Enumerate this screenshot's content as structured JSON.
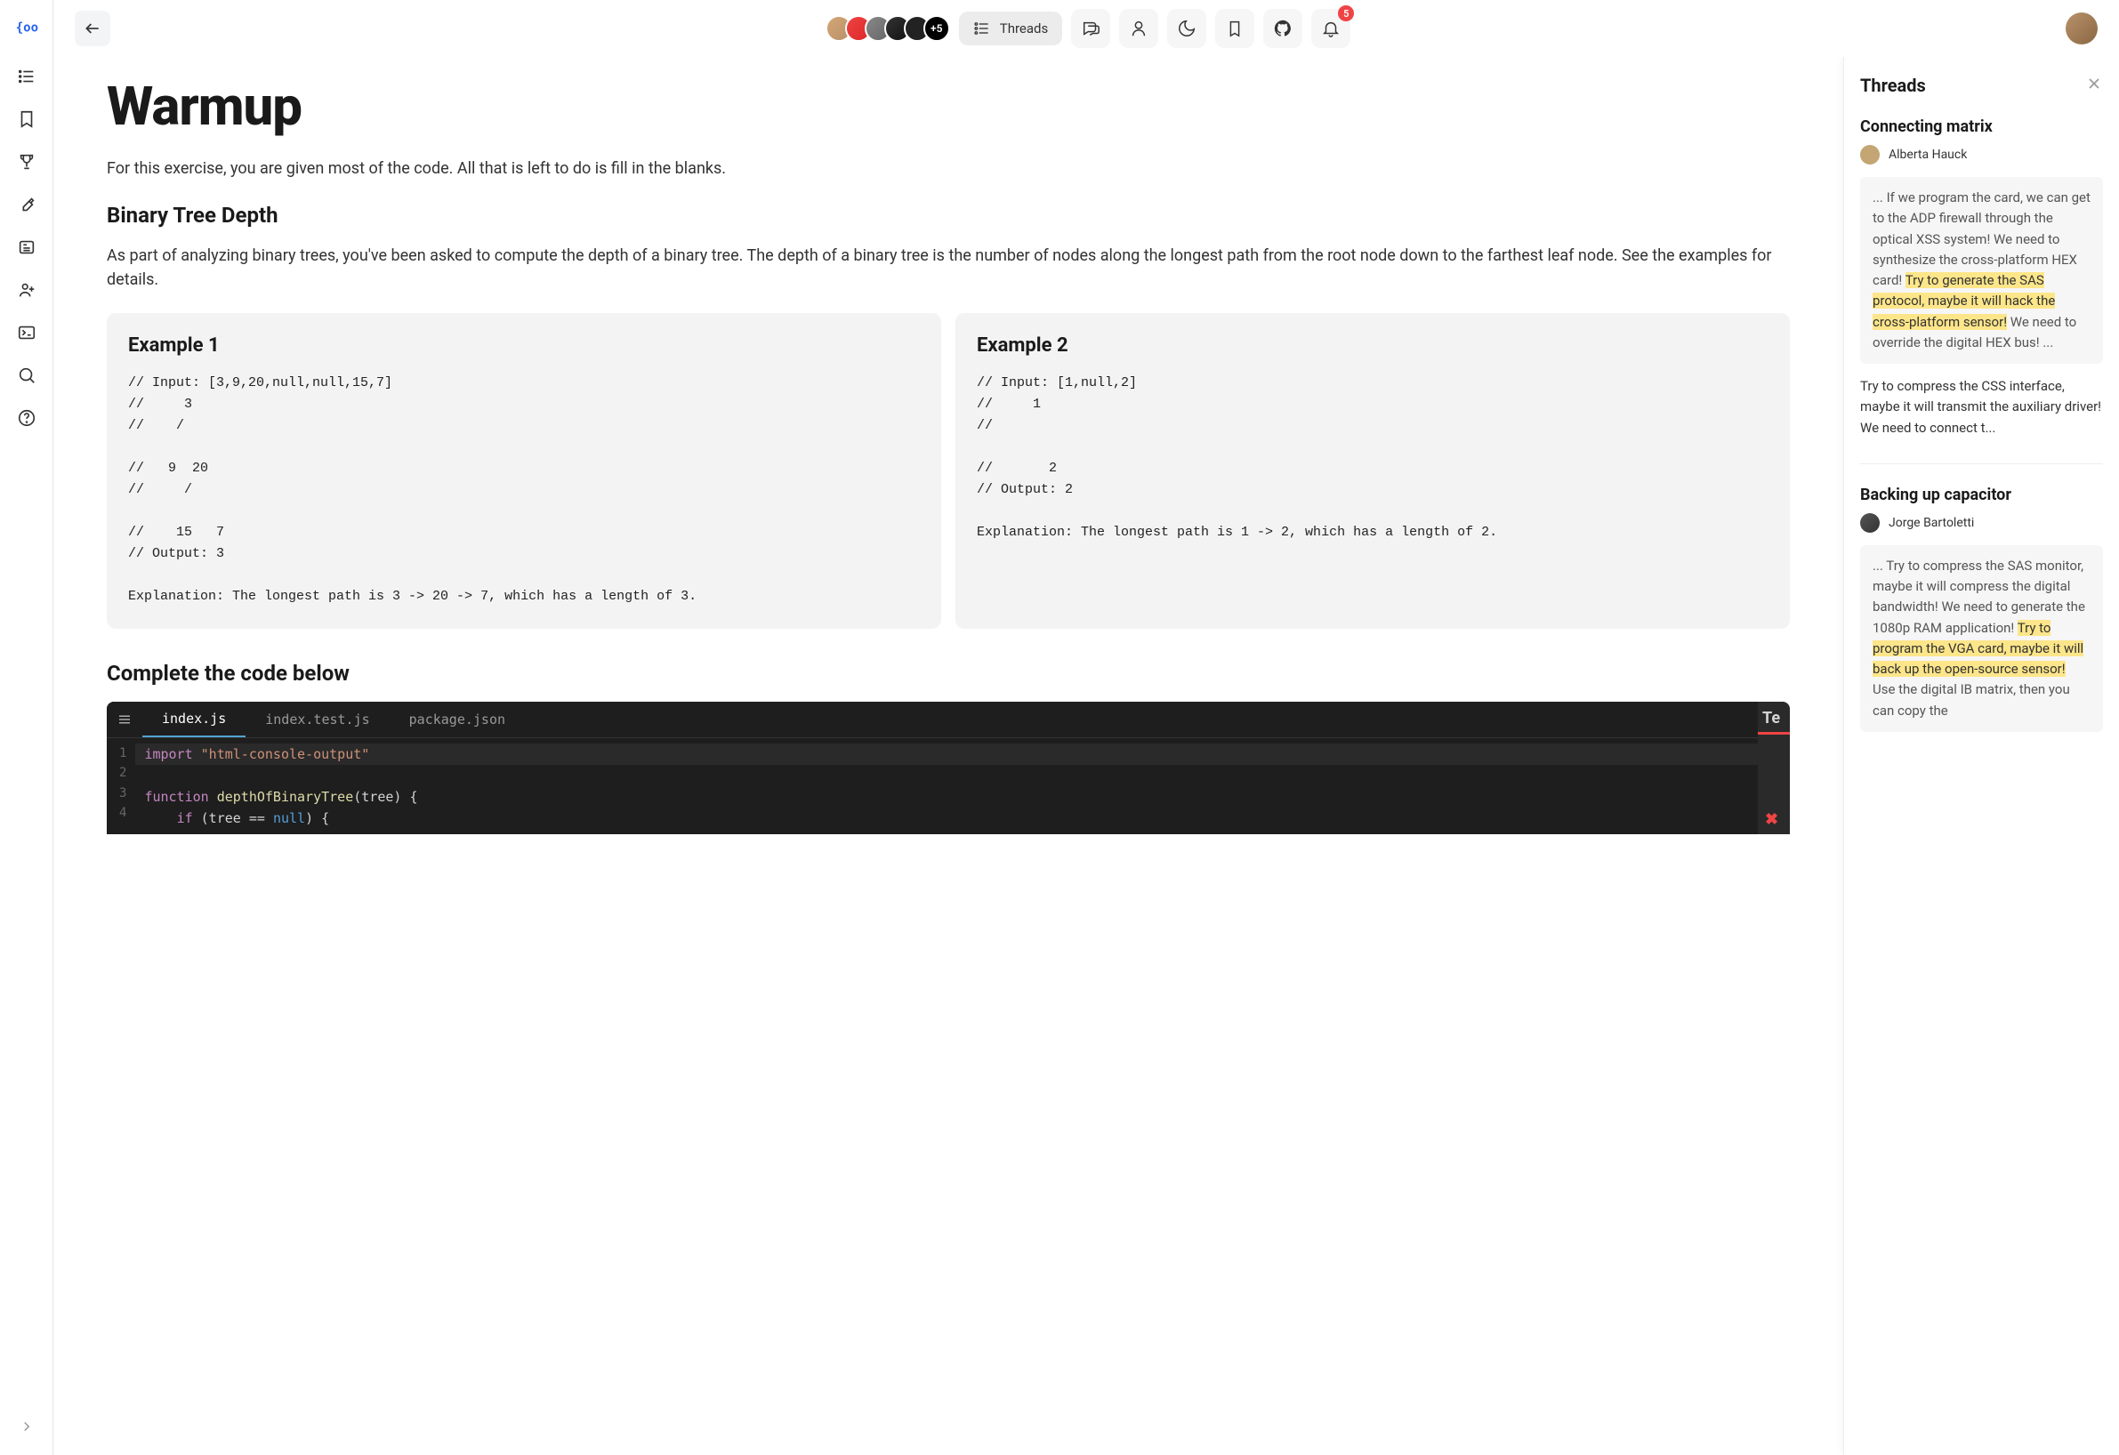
{
  "rail": {},
  "topbar": {
    "avatar_more": "+5",
    "threads_label": "Threads",
    "notification_count": "5"
  },
  "page": {
    "title": "Warmup",
    "intro": "For this exercise, you are given most of the code. All that is left to do is fill in the blanks.",
    "section_heading": "Binary Tree Depth",
    "section_body": "As part of analyzing binary trees, you've been asked to compute the depth of a binary tree. The depth of a binary tree is the number of nodes along the longest path from the root node down to the farthest leaf node. See the examples for details.",
    "examples": [
      {
        "title": "Example 1",
        "code": "// Input: [3,9,20,null,null,15,7]\n//     3\n//    /\n\n//   9  20\n//     /\n\n//    15   7\n// Output: 3\n\nExplanation: The longest path is 3 -> 20 -> 7, which has a length of 3."
      },
      {
        "title": "Example 2",
        "code": "// Input: [1,null,2]\n//     1\n//\n\n//       2\n// Output: 2\n\nExplanation: The longest path is 1 -> 2, which has a length of 2."
      }
    ],
    "complete_heading": "Complete the code below"
  },
  "editor": {
    "tabs": [
      {
        "label": "index.js",
        "active": true
      },
      {
        "label": "index.test.js",
        "active": false
      },
      {
        "label": "package.json",
        "active": false
      }
    ],
    "lines": [
      "1",
      "2",
      "3",
      "4"
    ],
    "code": {
      "l1_kw": "import",
      "l1_str": "\"html-console-output\"",
      "l3_kw": "function",
      "l3_fn": "depthOfBinaryTree",
      "l3_rest": "(tree) {",
      "l4_kw": "if",
      "l4_cond": " (tree == ",
      "l4_null": "null",
      "l4_end": ") {"
    },
    "test_label": "Te",
    "test_close": "✖"
  },
  "threads_panel": {
    "title": "Threads",
    "items": [
      {
        "title": "Connecting matrix",
        "author": "Alberta Hauck",
        "quote_pre": "... If we program the card, we can get to the ADP firewall through the optical XSS system! We need to synthesize the cross-platform HEX card! ",
        "quote_hl": "Try to generate the SAS protocol, maybe it will hack the cross-platform sensor!",
        "quote_post": " We need to override the digital HEX bus! ...",
        "reply": "Try to compress the CSS interface, maybe it will transmit the auxiliary driver! We need to connect t..."
      },
      {
        "title": "Backing up capacitor",
        "author": "Jorge Bartoletti",
        "quote_pre": "... Try to compress the SAS monitor, maybe it will compress the digital bandwidth! We need to generate the 1080p RAM application! ",
        "quote_hl": "Try to program the VGA card, maybe it will back up the open-source sensor!",
        "quote_post": " Use the digital IB matrix, then you can copy the"
      }
    ]
  }
}
